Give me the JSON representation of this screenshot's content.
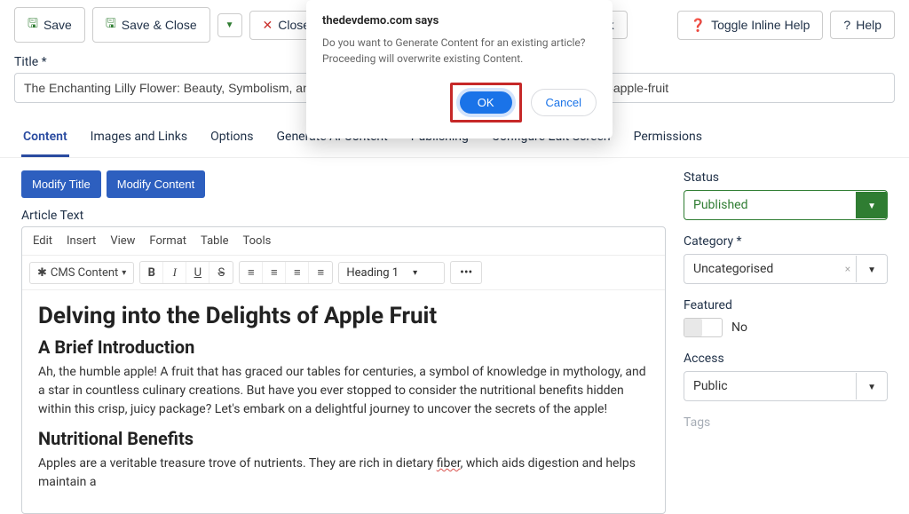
{
  "toolbar": {
    "save": "Save",
    "save_close": "Save & Close",
    "close": "Close",
    "check": "eck",
    "toggle_help": "Toggle Inline Help",
    "help": "Help"
  },
  "fields": {
    "title_label": "Title *",
    "title_value": "The Enchanting Lilly Flower: Beauty, Symbolism, and Fasc",
    "alias_value": "efits-and-culinary-uses-of-apple-fruit"
  },
  "tabs": [
    "Content",
    "Images and Links",
    "Options",
    "Generate AI Content",
    "Publishing",
    "Configure Edit Screen",
    "Permissions"
  ],
  "mini_buttons": {
    "modify_title": "Modify Title",
    "modify_content": "Modify Content"
  },
  "editor": {
    "label": "Article Text",
    "menu": [
      "Edit",
      "Insert",
      "View",
      "Format",
      "Table",
      "Tools"
    ],
    "cms_btn": "CMS Content",
    "heading": "Heading 1",
    "doc": {
      "h1": "Delving into the Delights of Apple Fruit",
      "h2a": "A Brief Introduction",
      "p1": "Ah, the humble apple! A fruit that has graced our tables for centuries, a symbol of knowledge in mythology, and a star in countless culinary creations. But have you ever stopped to consider the nutritional benefits hidden within this crisp, juicy package? Let's embark on a delightful journey to uncover the secrets of the apple!",
      "h2b": "Nutritional Benefits",
      "p2a": "Apples are a veritable treasure trove of nutrients. They are rich in dietary ",
      "p2_wavy": "fiber",
      "p2b": ", which aids digestion and helps maintain a"
    }
  },
  "sidebar": {
    "status_label": "Status",
    "status_value": "Published",
    "category_label": "Category *",
    "category_value": "Uncategorised",
    "featured_label": "Featured",
    "featured_no": "No",
    "access_label": "Access",
    "access_value": "Public",
    "tags_label": "Tags"
  },
  "dialog": {
    "title": "thedevdemo.com says",
    "message": "Do you want to Generate Content for an existing article? Proceeding will overwrite existing Content.",
    "ok": "OK",
    "cancel": "Cancel"
  }
}
